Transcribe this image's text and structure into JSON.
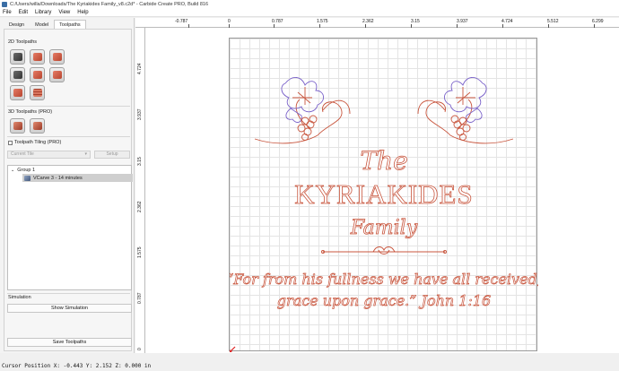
{
  "window": {
    "title": "C:/Users/willa/Downloads/The Kyriakides Family_v8.c2d* - Carbide Create PRO, Build 816"
  },
  "menu": [
    "File",
    "Edit",
    "Library",
    "View",
    "Help"
  ],
  "tabs": [
    {
      "label": "Design"
    },
    {
      "label": "Model"
    },
    {
      "label": "Toolpaths"
    }
  ],
  "toolpaths": {
    "section_2d": "2D Toolpaths",
    "section_3d": "3D Toolpaths (PRO)",
    "tiling_label": "Toolpath Tiling (PRO)",
    "current_tile": "Current Tile",
    "setup_label": "Setup",
    "group_label": "Group 1",
    "item_label": "VCarve 3 - 14 minutes",
    "simulation_section": "Simulation",
    "show_simulation": "Show Simulation",
    "save_toolpaths": "Save Toolpaths"
  },
  "ruler": {
    "top": [
      "-0.787",
      "0",
      "0.787",
      "1.575",
      "2.362",
      "3.15",
      "3.937",
      "4.724",
      "5.512",
      "6.299"
    ],
    "left": [
      "4.724",
      "3.937",
      "3.15",
      "2.362",
      "1.575",
      "0.787",
      "0"
    ]
  },
  "design": {
    "line1": "The",
    "line2": "KYRIAKIDES",
    "line3": "Family",
    "quote1": "“For from his fullness we have all received,",
    "quote2": "grace upon grace.” John 1:16",
    "accent_color": "#c8553d",
    "leaf_outline_color": "#7a62c9"
  },
  "status": "Cursor Position X: -0.443 Y: 2.152 Z: 0.000 in"
}
